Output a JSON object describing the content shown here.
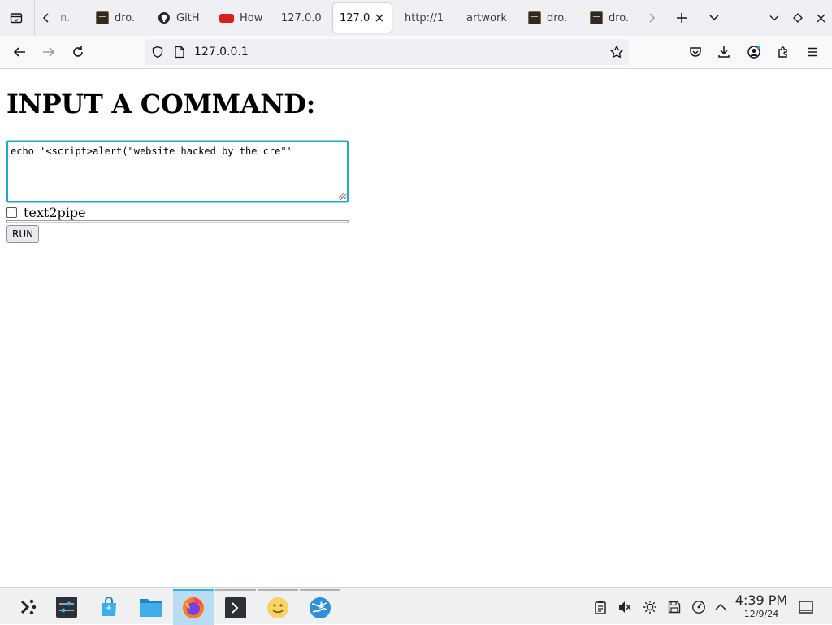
{
  "browser": {
    "tabs": [
      {
        "label": "n.",
        "favicon": "dark-thumbnail-icon"
      },
      {
        "label": "dro.",
        "favicon": "dark-thumbnail-icon"
      },
      {
        "label": "GitH",
        "favicon": "github-icon"
      },
      {
        "label": "How",
        "favicon": "red-badge-icon"
      },
      {
        "label": "127.0.0",
        "favicon": "none"
      },
      {
        "label": "127.0",
        "favicon": "none",
        "active": true
      },
      {
        "label": "http://1",
        "favicon": "none"
      },
      {
        "label": "artwork",
        "favicon": "none"
      },
      {
        "label": "dro.",
        "favicon": "dark-thumbnail-icon"
      },
      {
        "label": "dro.",
        "favicon": "dark-thumbnail-icon"
      }
    ],
    "url": "127.0.0.1",
    "accent": "#23a6c8"
  },
  "page": {
    "title": "INPUT A COMMAND:",
    "command_value": "echo '<script>alert(\"website hacked by the cre\"'",
    "checkbox_label": "text2pipe",
    "checkbox_checked": false,
    "run_label": "RUN"
  },
  "taskbar": {
    "time": "4:39 PM",
    "date": "12/9/24",
    "apps": [
      "app-launcher-icon",
      "system-settings-icon",
      "discover-store-icon",
      "file-manager-icon",
      "firefox-icon",
      "terminal-icon",
      "smiley-app-icon",
      "globe-app-icon"
    ]
  }
}
